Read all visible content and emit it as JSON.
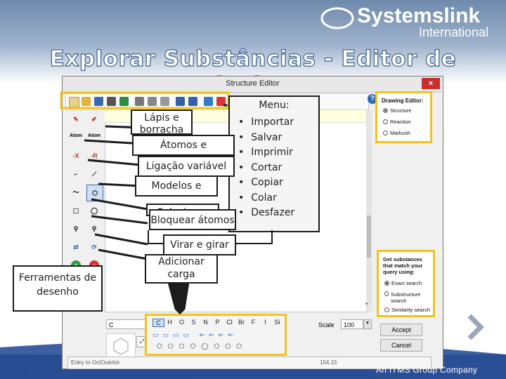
{
  "header": {
    "logo_name": "Systemslink",
    "logo_sub": "International",
    "title": "Explorar Substâncias - Editor de estruturas",
    "footer": "An ITMS Group Company"
  },
  "editor": {
    "window_title": "Structure Editor",
    "close": "×",
    "help": "?",
    "note_text": "implates.",
    "left_tools": [
      "Atom",
      "Atom",
      "-X",
      "-R"
    ],
    "status_left": "Entry to OctOuertor",
    "status_right": "154.15"
  },
  "drawing_panel": {
    "title": "Drawing Editor:",
    "options": [
      "Structure",
      "Reaction",
      "Markush"
    ],
    "selected": "Structure"
  },
  "search_panel": {
    "title": "Get substances that match your query using:",
    "options": [
      "Exact search",
      "Substructure search",
      "Similarity search"
    ],
    "selected": "Exact search"
  },
  "symbols": {
    "elements": [
      "C",
      "H",
      "O",
      "S",
      "N",
      "P",
      "Cl",
      "Br",
      "F",
      "I",
      "Si"
    ],
    "left_value": "C",
    "scale_label": "Scale",
    "scale_value": "100"
  },
  "buttons": {
    "accept": "Accept",
    "cancel": "Cancel"
  },
  "callouts": {
    "menu_title": "Menu:",
    "menu_items": [
      "Importar",
      "Salvar",
      "Imprimir",
      "Cortar",
      "Copiar",
      "Colar",
      "Desfazer"
    ],
    "lapis": "Lápis e borracha",
    "atomos": "Átomos e estruturas",
    "ligacao": "Ligação variável",
    "modelos": "Modelos e",
    "selecionar": "Selecionar",
    "bloquear": "Bloquear átomos",
    "virar": "Virar e girar",
    "adicionar": "Adicionar carga",
    "ferramentas": "Ferramentas de desenho"
  },
  "colors": {
    "background_top": "#7d96b6",
    "highlight": "#f0c419",
    "title_outline": "#3d5f8c",
    "arrow": "#1c1c1c"
  }
}
